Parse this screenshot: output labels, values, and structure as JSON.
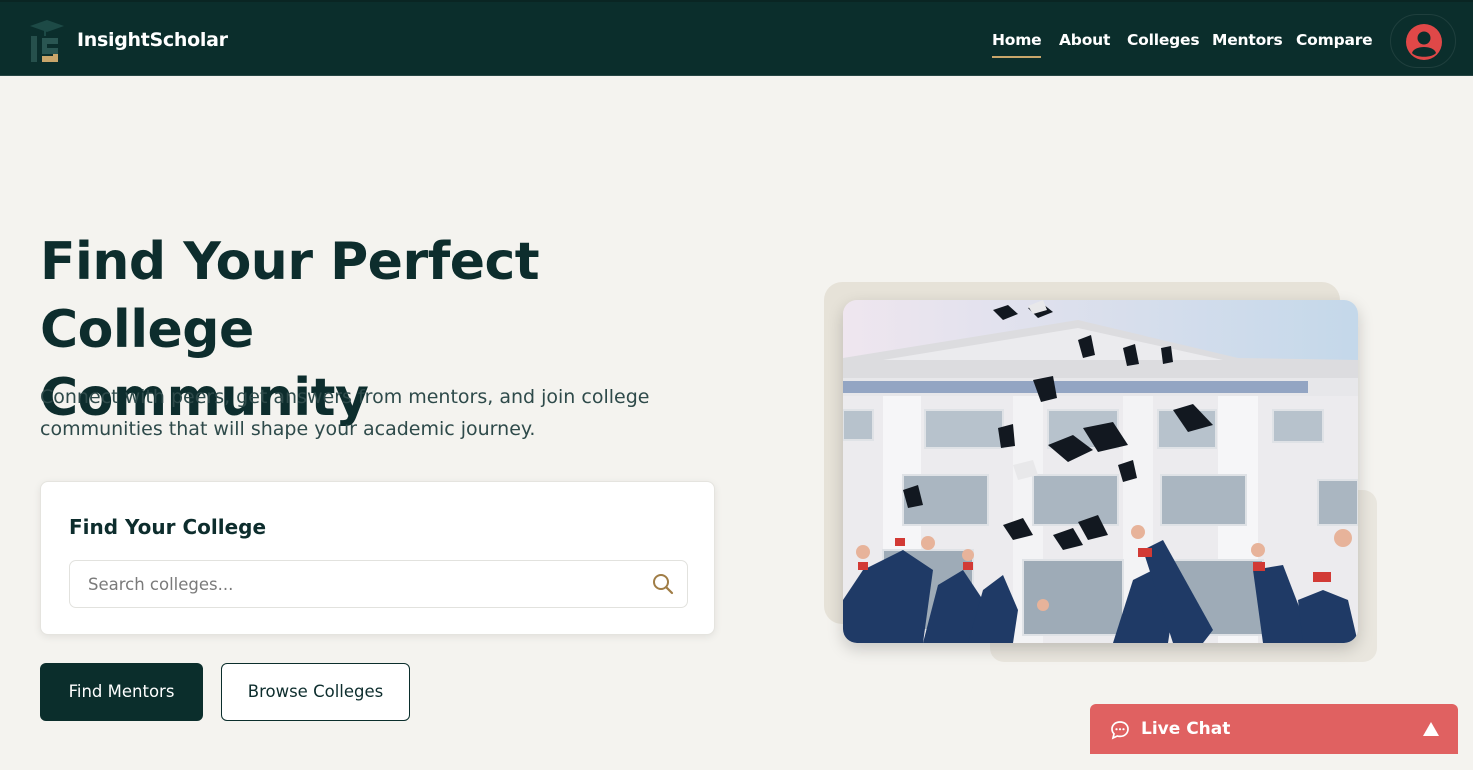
{
  "header": {
    "brand": "InsightScholar",
    "nav": [
      {
        "label": "Home",
        "active": true
      },
      {
        "label": "About",
        "active": false
      },
      {
        "label": "Colleges",
        "active": false
      },
      {
        "label": "Mentors",
        "active": false
      },
      {
        "label": "Compare",
        "active": false
      }
    ],
    "icons": {
      "logo": "graduation-cap-logo",
      "avatar": "user-avatar-icon"
    }
  },
  "hero": {
    "title_line1": "Find Your Perfect College",
    "title_line2": "Community",
    "subtitle_line1": "Connect with peers, get answers from mentors, and join college",
    "subtitle_line2": "communities that will shape your academic journey."
  },
  "search": {
    "title": "Find Your College",
    "placeholder": "Search colleges...",
    "value": "",
    "icon": "search-icon"
  },
  "actions": {
    "primary": "Find Mentors",
    "secondary": "Browse Colleges"
  },
  "image": {
    "alt": "graduates-throwing-caps-photo"
  },
  "live_chat": {
    "label": "Live Chat",
    "icon": "chat-bubble-icon",
    "toggle_icon": "triangle-up-icon"
  },
  "colors": {
    "primary": "#0b2e2c",
    "accent": "#c9a66b",
    "background": "#f4f3ef",
    "chat": "#e06161",
    "avatar": "#e04848"
  }
}
